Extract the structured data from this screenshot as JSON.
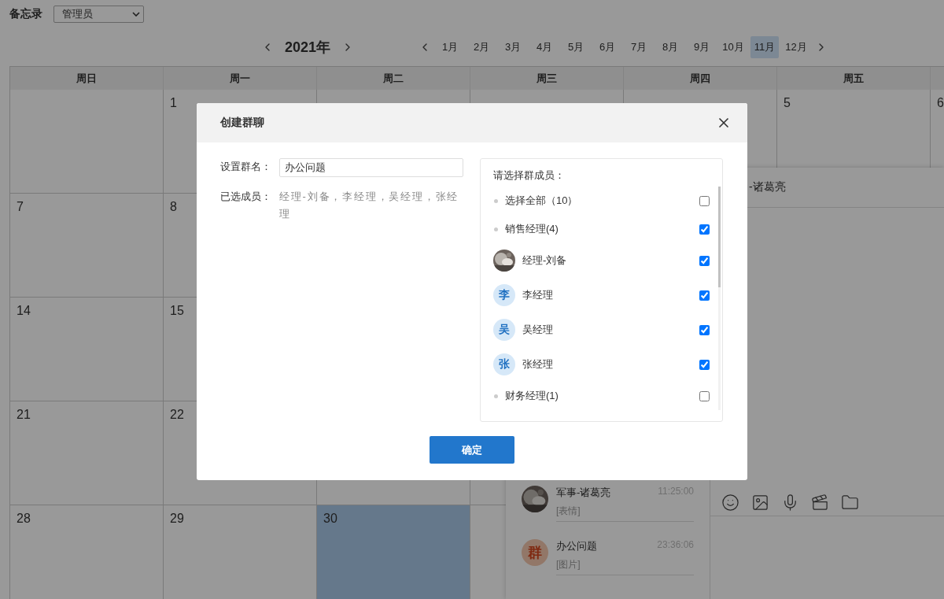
{
  "app": {
    "title": "备忘录",
    "role_select": "管理员"
  },
  "year_nav": {
    "year": "2021年"
  },
  "months": [
    {
      "label": "1月",
      "selected": false
    },
    {
      "label": "2月",
      "selected": false
    },
    {
      "label": "3月",
      "selected": false
    },
    {
      "label": "4月",
      "selected": false
    },
    {
      "label": "5月",
      "selected": false
    },
    {
      "label": "6月",
      "selected": false
    },
    {
      "label": "7月",
      "selected": false
    },
    {
      "label": "8月",
      "selected": false
    },
    {
      "label": "9月",
      "selected": false
    },
    {
      "label": "10月",
      "selected": false
    },
    {
      "label": "11月",
      "selected": true
    },
    {
      "label": "12月",
      "selected": false
    }
  ],
  "calendar": {
    "weekdays": [
      "周日",
      "周一",
      "周二",
      "周三",
      "周四",
      "周五"
    ],
    "weeks": [
      {
        "sun": {
          "today": false
        },
        "mon": {
          "day": "1",
          "today": false
        },
        "fri": {
          "day": "5",
          "today": false
        },
        "sat": {
          "day": "6",
          "today": false
        }
      },
      {
        "sun": {
          "day": "7",
          "today": false
        },
        "mon": {
          "day": "8",
          "today": false
        }
      },
      {
        "sun": {
          "day": "14",
          "today": false
        },
        "mon": {
          "day": "15",
          "today": false
        }
      },
      {
        "sun": {
          "day": "21",
          "today": false
        },
        "mon": {
          "day": "22",
          "today": false
        },
        "tue": {
          "today": false
        }
      },
      {
        "sun": {
          "day": "28",
          "today": false
        },
        "mon": {
          "day": "29",
          "today": false
        },
        "tue": {
          "day": "30",
          "today": true
        }
      }
    ]
  },
  "chat": {
    "header_title": "-诸葛亮",
    "conversations": [
      {
        "name": "军事-诸葛亮",
        "time": "11:25:00",
        "preview": "[表情]"
      },
      {
        "kind": "group",
        "avatar_text": "群",
        "name": "办公问题",
        "time": "23:36:06",
        "preview": "[图片]"
      }
    ]
  },
  "dialog": {
    "title": "创建群聊",
    "group_name_label": "设置群名：",
    "group_name_value": "办公问题",
    "selected_label": "已选成员：",
    "selected_members": "经理-刘备，李经理，吴经理，张经理",
    "member_panel": {
      "title": "请选择群成员：",
      "items": [
        {
          "kind": "group",
          "label": "选择全部（10）",
          "checked": false
        },
        {
          "kind": "group",
          "label": "销售经理(4)",
          "checked": true
        },
        {
          "label": "经理-刘备",
          "checked": true
        },
        {
          "kind": "member",
          "avatar_text": "李",
          "label": "李经理",
          "checked": true
        },
        {
          "kind": "member",
          "avatar_text": "吴",
          "label": "吴经理",
          "checked": true
        },
        {
          "kind": "member",
          "avatar_text": "张",
          "label": "张经理",
          "checked": true
        },
        {
          "kind": "group",
          "label": "财务经理(1)",
          "checked": false
        }
      ]
    },
    "confirm": "确定"
  }
}
